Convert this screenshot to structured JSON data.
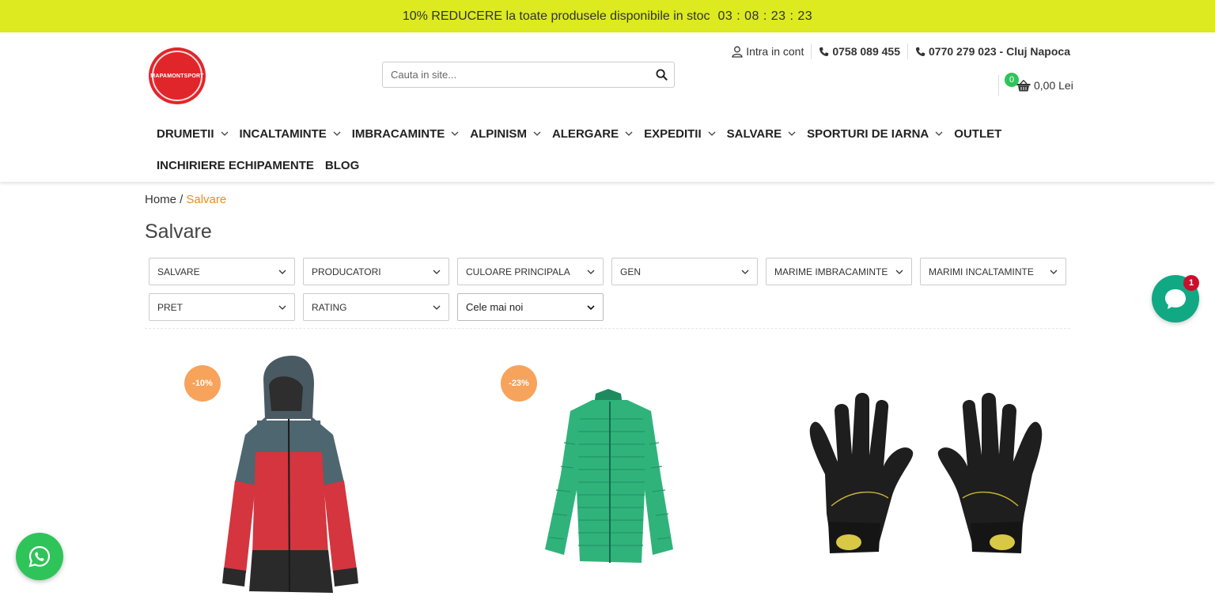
{
  "promo": {
    "text": "10% REDUCERE la toate produsele disponibile in stoc",
    "timer": "03 : 08 : 23 : 23"
  },
  "header": {
    "logo_text": "MAPAMONTSPORT",
    "search_placeholder": "Cauta in site...",
    "account_label": "Intra in cont",
    "phone1": "0758 089 455",
    "phone2": "0770 279 023 - Cluj Napoca",
    "cart_count": "0",
    "cart_total": "0,00 Lei"
  },
  "nav": {
    "items": [
      {
        "label": "DRUMETII"
      },
      {
        "label": "INCALTAMINTE"
      },
      {
        "label": "IMBRACAMINTE"
      },
      {
        "label": "ALPINISM"
      },
      {
        "label": "ALERGARE"
      },
      {
        "label": "EXPEDITII"
      },
      {
        "label": "SALVARE"
      },
      {
        "label": "SPORTURI DE IARNA"
      },
      {
        "label": "OUTLET"
      },
      {
        "label": "INCHIRIERE ECHIPAMENTE"
      },
      {
        "label": "BLOG"
      }
    ]
  },
  "breadcrumb": {
    "home": "Home /",
    "current": "Salvare"
  },
  "page": {
    "title": "Salvare"
  },
  "filters": {
    "items": [
      {
        "label": "SALVARE"
      },
      {
        "label": "PRODUCATORI"
      },
      {
        "label": "CULOARE PRINCIPALA"
      },
      {
        "label": "GEN"
      },
      {
        "label": "MARIME IMBRACAMINTE"
      },
      {
        "label": "MARIMI INCALTAMINTE"
      },
      {
        "label": "PRET"
      },
      {
        "label": "RATING"
      }
    ],
    "sort_selected": "Cele mai noi"
  },
  "products": {
    "items": [
      {
        "badge": "-10%"
      },
      {
        "badge": "-23%"
      },
      {
        "badge": ""
      }
    ]
  },
  "widgets": {
    "chat_unread": "1"
  },
  "colors": {
    "promo_bg": "#dcea1f",
    "accent_orange": "#f08a24",
    "badge_orange": "#f7a35c",
    "logo_red": "#e1262b",
    "cart_green": "#2fc45a",
    "chat_teal": "#11a984"
  }
}
